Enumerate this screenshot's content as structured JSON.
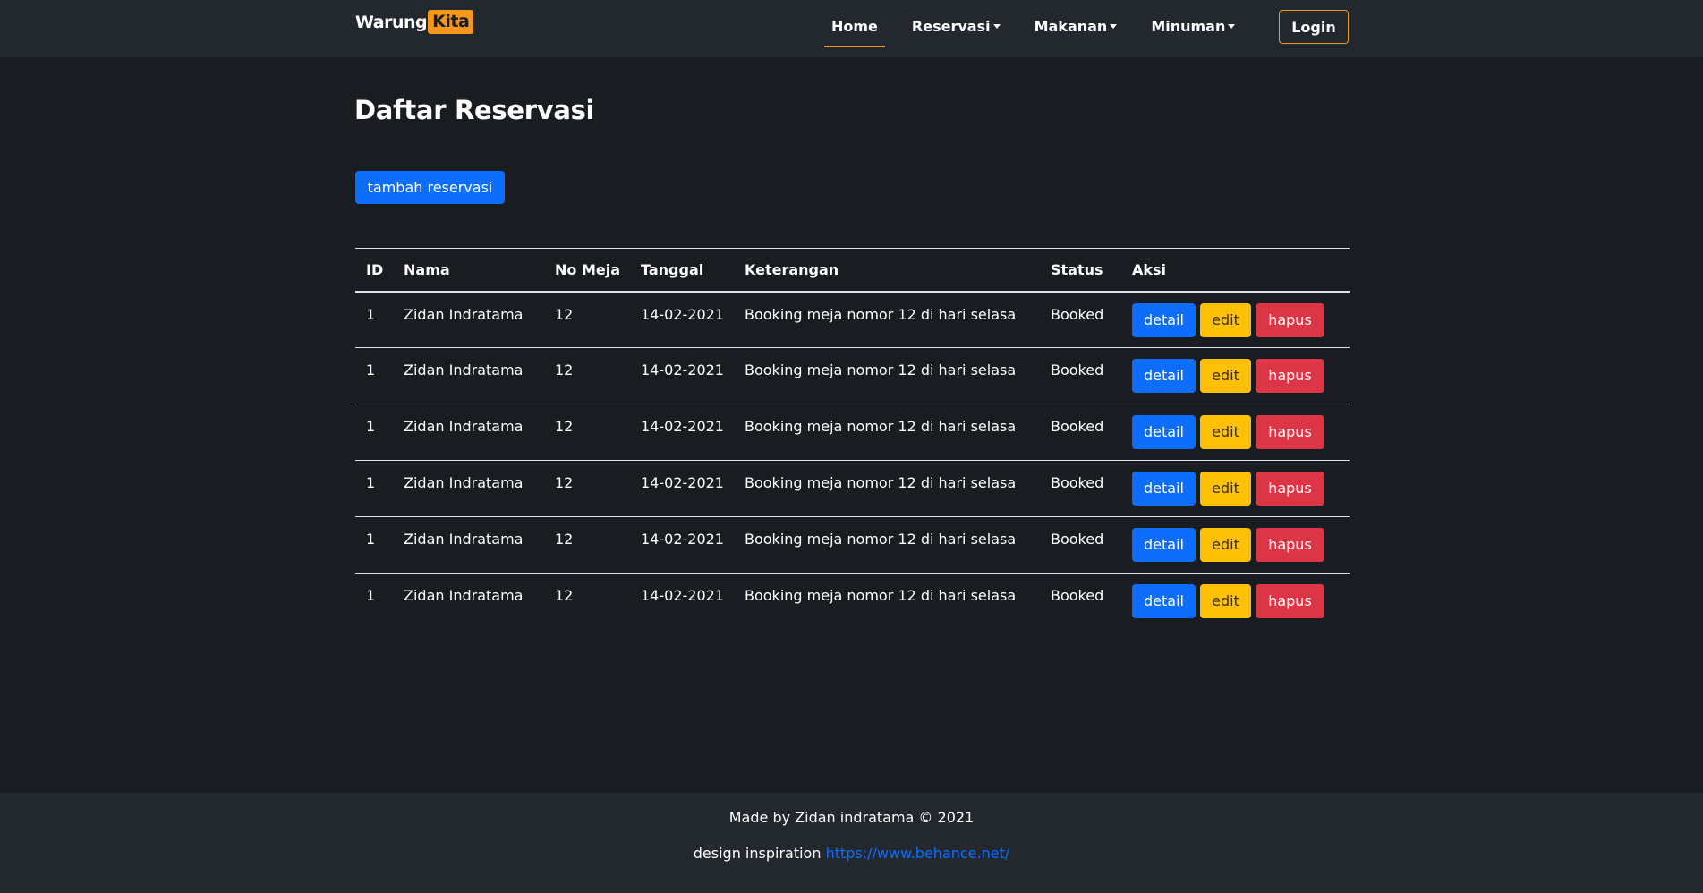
{
  "navbar": {
    "brand_part1": "Warung",
    "brand_part2": "Kita",
    "links": [
      {
        "label": "Home",
        "active": true,
        "dropdown": false
      },
      {
        "label": "Reservasi",
        "active": false,
        "dropdown": true
      },
      {
        "label": "Makanan",
        "active": false,
        "dropdown": true
      },
      {
        "label": "Minuman",
        "active": false,
        "dropdown": true
      }
    ],
    "login_label": "Login"
  },
  "main": {
    "title": "Daftar Reservasi",
    "add_button_label": "tambah reservasi",
    "table": {
      "headers": [
        "ID",
        "Nama",
        "No Meja",
        "Tanggal",
        "Keterangan",
        "Status",
        "Aksi"
      ],
      "rows": [
        {
          "id": "1",
          "nama": "Zidan Indratama",
          "no_meja": "12",
          "tanggal": "14-02-2021",
          "keterangan": "Booking meja nomor 12 di hari selasa",
          "status": "Booked"
        },
        {
          "id": "1",
          "nama": "Zidan Indratama",
          "no_meja": "12",
          "tanggal": "14-02-2021",
          "keterangan": "Booking meja nomor 12 di hari selasa",
          "status": "Booked"
        },
        {
          "id": "1",
          "nama": "Zidan Indratama",
          "no_meja": "12",
          "tanggal": "14-02-2021",
          "keterangan": "Booking meja nomor 12 di hari selasa",
          "status": "Booked"
        },
        {
          "id": "1",
          "nama": "Zidan Indratama",
          "no_meja": "12",
          "tanggal": "14-02-2021",
          "keterangan": "Booking meja nomor 12 di hari selasa",
          "status": "Booked"
        },
        {
          "id": "1",
          "nama": "Zidan Indratama",
          "no_meja": "12",
          "tanggal": "14-02-2021",
          "keterangan": "Booking meja nomor 12 di hari selasa",
          "status": "Booked"
        },
        {
          "id": "1",
          "nama": "Zidan Indratama",
          "no_meja": "12",
          "tanggal": "14-02-2021",
          "keterangan": "Booking meja nomor 12 di hari selasa",
          "status": "Booked"
        }
      ],
      "actions": {
        "detail_label": "detail",
        "edit_label": "edit",
        "hapus_label": "hapus"
      }
    }
  },
  "footer": {
    "credit": "Made by Zidan indratama © 2021",
    "inspiration_label": "design inspiration",
    "inspiration_link": "https://www.behance.net/"
  },
  "colors": {
    "accent": "#f5961d",
    "primary": "#0d6efd",
    "warning": "#ffc107",
    "danger": "#dc3545",
    "background": "#191c20",
    "navbar_footer": "#23272e"
  }
}
